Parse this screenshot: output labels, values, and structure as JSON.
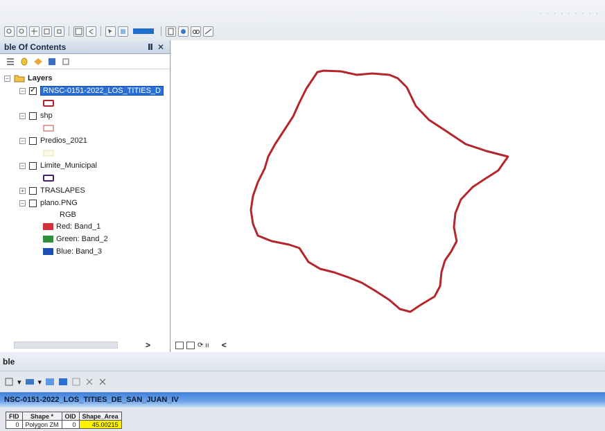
{
  "top_right_text": "· · · · · · · · ·",
  "toc": {
    "title": "ble Of Contents",
    "pin": "Ⅱ",
    "close": "✕",
    "root": "Layers",
    "layers": [
      {
        "name": "RNSC-0151-2022_LOS_TITIES_D",
        "checked": true,
        "selected": true,
        "symbol_color": "#b3202a"
      },
      {
        "name": "shp",
        "checked": false,
        "symbol_color": "#c0453f"
      },
      {
        "name": "Predios_2021",
        "checked": false,
        "symbol_color": "#e6e2b0"
      },
      {
        "name": "Limite_Municipal",
        "checked": false,
        "symbol_color": "#4b2266"
      },
      {
        "name": "TRASLAPES",
        "checked": false
      },
      {
        "name": "plano.PNG",
        "checked": false
      }
    ],
    "raster": {
      "label": "RGB",
      "bands": [
        {
          "label": "Red:  Band_1",
          "color": "#d2303a"
        },
        {
          "label": "Green: Band_2",
          "color": "#2f8f3a"
        },
        {
          "label": "Blue:  Band_3",
          "color": "#1c4fb0"
        }
      ]
    },
    "scroll_right": ">"
  },
  "map": {
    "polygon_color": "#b3262c",
    "status_arrow": "<",
    "status_text": "⟳ ıı"
  },
  "table": {
    "header": "ble",
    "title": "NSC-0151-2022_LOS_TITIES_DE_SAN_JUAN_IV",
    "columns": [
      "FID",
      "Shape *",
      "OID",
      "Shape_Area"
    ],
    "rows": [
      [
        "0",
        "Polygon ZM",
        "0",
        "45.00215"
      ]
    ]
  }
}
